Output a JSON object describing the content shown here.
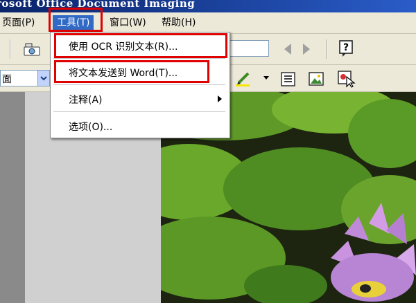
{
  "window": {
    "title": "rosoft Office Document Imaging"
  },
  "menubar": {
    "items": [
      {
        "label": "页面(P)"
      },
      {
        "label": "工具(T)"
      },
      {
        "label": "窗口(W)"
      },
      {
        "label": "帮助(H)"
      }
    ]
  },
  "toolbar": {
    "zoom_value": "面"
  },
  "tools_menu": {
    "items": [
      {
        "label": "使用 OCR 识别文本(R)..."
      },
      {
        "label": "将文本发送到 Word(T)..."
      },
      {
        "label": "注释(A)"
      },
      {
        "label": "选项(O)..."
      }
    ]
  },
  "colors": {
    "highlight_box": "#e00000",
    "menu_active": "#316ac5",
    "title_bar": "#0a246a"
  }
}
